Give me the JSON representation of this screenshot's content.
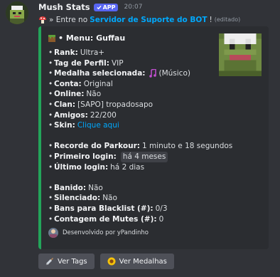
{
  "message": {
    "author": "Mush Stats",
    "app_badge": "APP",
    "timestamp": "20:07",
    "content": {
      "prefix": "» Entre no",
      "link": "Servidor de Suporte do BOT",
      "suffix": "!",
      "edited": "(editado)"
    }
  },
  "embed": {
    "accent_color": "#23a55a",
    "title": "• Menu: Guffau",
    "fields": [
      {
        "label": "Rank:",
        "value": "Ultra+"
      },
      {
        "label": "Tag de Perfil:",
        "value": "VIP"
      },
      {
        "label": "Medalha selecionada:",
        "value": "(Músico)",
        "icon": "music-note-icon"
      },
      {
        "label": "Conta:",
        "value": "Original"
      },
      {
        "label": "Online:",
        "value": "Não"
      },
      {
        "label": "Clan:",
        "value": "[SAPO] tropadosapo"
      },
      {
        "label": "Amigos:",
        "value": "22/200"
      },
      {
        "label": "Skin:",
        "value": "Clique aqui",
        "link": true
      },
      {
        "label": "Recorde do Parkour:",
        "value": "1 minuto e 18 segundos"
      },
      {
        "label": "Primeiro login:",
        "value": "há 4 meses",
        "chip": true
      },
      {
        "label": "Último login:",
        "value": "há 2 dias"
      },
      {
        "label": "Banido:",
        "value": "Não"
      },
      {
        "label": "Silenciado:",
        "value": "Não"
      },
      {
        "label": "Bans para Blacklist (#):",
        "value": "0/3"
      },
      {
        "label": "Contagem de Mutes (#):",
        "value": "0"
      }
    ],
    "footer": "Desenvolvido por yPandinho"
  },
  "buttons": [
    {
      "label": "Ver Tags",
      "icon": "syringe-icon"
    },
    {
      "label": "Ver Medalhas",
      "icon": "sunflower-icon"
    }
  ]
}
